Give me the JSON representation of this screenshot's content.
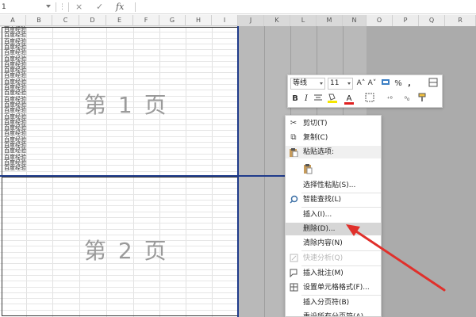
{
  "formula_bar": {
    "name_box": "1",
    "fx_label": "fx",
    "cancel_icon": "×",
    "confirm_icon": "✓"
  },
  "columns": [
    "A",
    "B",
    "C",
    "D",
    "E",
    "F",
    "G",
    "H",
    "I",
    "J",
    "K",
    "L",
    "M",
    "N",
    "O",
    "P",
    "Q",
    "R"
  ],
  "rows_text": "百度经验",
  "watermarks": {
    "page1": "第 1 页",
    "page2": "第 2 页"
  },
  "mini_toolbar": {
    "font": "等线",
    "size": "11",
    "bold": "B",
    "italic": "I",
    "font_color_letter": "A",
    "increase_font": "A˄",
    "decrease_font": "A˅",
    "percent": "%",
    "comma": ",",
    "inc_decimal": "⁺⁰",
    "dec_decimal": "⁰₀"
  },
  "context_menu": {
    "cut": "剪切(T)",
    "copy": "复制(C)",
    "paste_options": "粘贴选项:",
    "paste_special": "选择性粘贴(S)...",
    "smart_lookup": "智能查找(L)",
    "insert": "插入(I)...",
    "delete": "删除(D)...",
    "clear_contents": "清除内容(N)",
    "quick_analysis": "快速分析(Q)",
    "insert_comment": "插入批注(M)",
    "format_cells": "设置单元格格式(F)...",
    "insert_page_break": "插入分页符(B)",
    "reset_page_breaks": "重设所有分页符(A)"
  },
  "icons": {
    "cut": "scissors-icon",
    "copy": "copy-icon",
    "paste_header": "clipboard-icon",
    "paste_option": "paste-icon",
    "smart_lookup": "search-icon",
    "quick_analysis": "quick-analysis-icon",
    "insert_comment": "comment-icon",
    "format_cells": "format-cells-icon"
  },
  "colors": {
    "page_break_line": "#1f3b8b",
    "gray_area": "#ababab",
    "arrow": "#e0302b",
    "font_color_bar": "#e02020",
    "fill_color_bar": "#f5e600"
  }
}
